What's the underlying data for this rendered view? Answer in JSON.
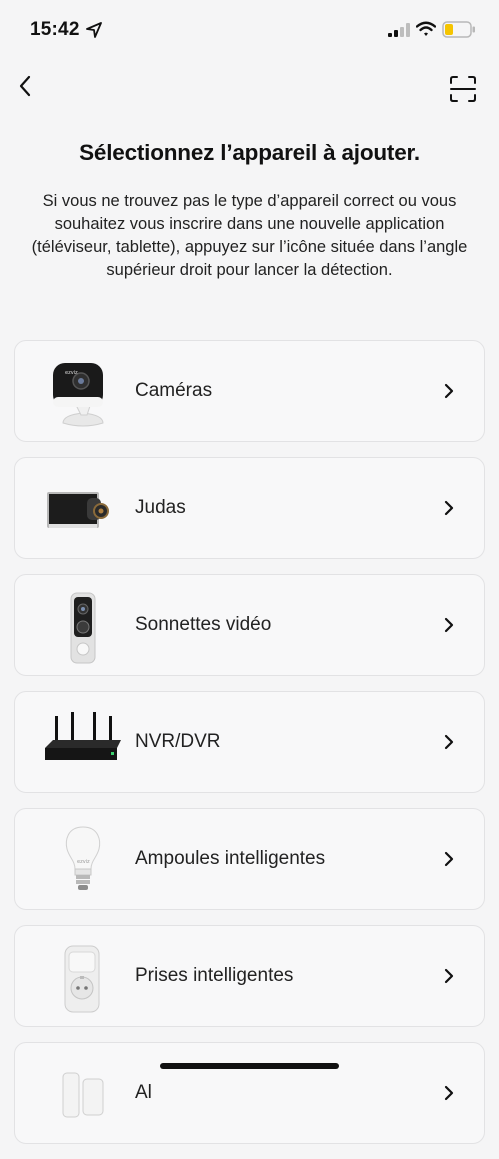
{
  "status_bar": {
    "time": "15:42"
  },
  "title": "Sélectionnez l’appareil à ajouter.",
  "description": "Si vous ne trouvez pas le type d’appareil correct ou vous souhaitez vous inscrire dans une nouvelle application (téléviseur, tablette), appuyez sur l’icône située dans l’angle supérieur droit pour lancer la détection.",
  "devices": [
    {
      "label": "Caméras",
      "icon": "camera-icon"
    },
    {
      "label": "Judas",
      "icon": "door-viewer-icon"
    },
    {
      "label": "Sonnettes vidéo",
      "icon": "doorbell-icon"
    },
    {
      "label": "NVR/DVR",
      "icon": "recorder-icon"
    },
    {
      "label": "Ampoules intelligentes",
      "icon": "bulb-icon"
    },
    {
      "label": "Prises intelligentes",
      "icon": "plug-icon"
    },
    {
      "label": "Al",
      "icon": "alarm-sensor-icon"
    }
  ],
  "colors": {
    "background": "#f5f5f6",
    "card": "#f8f8f9",
    "border": "#e2e2e4",
    "battery": "#f5c400"
  }
}
